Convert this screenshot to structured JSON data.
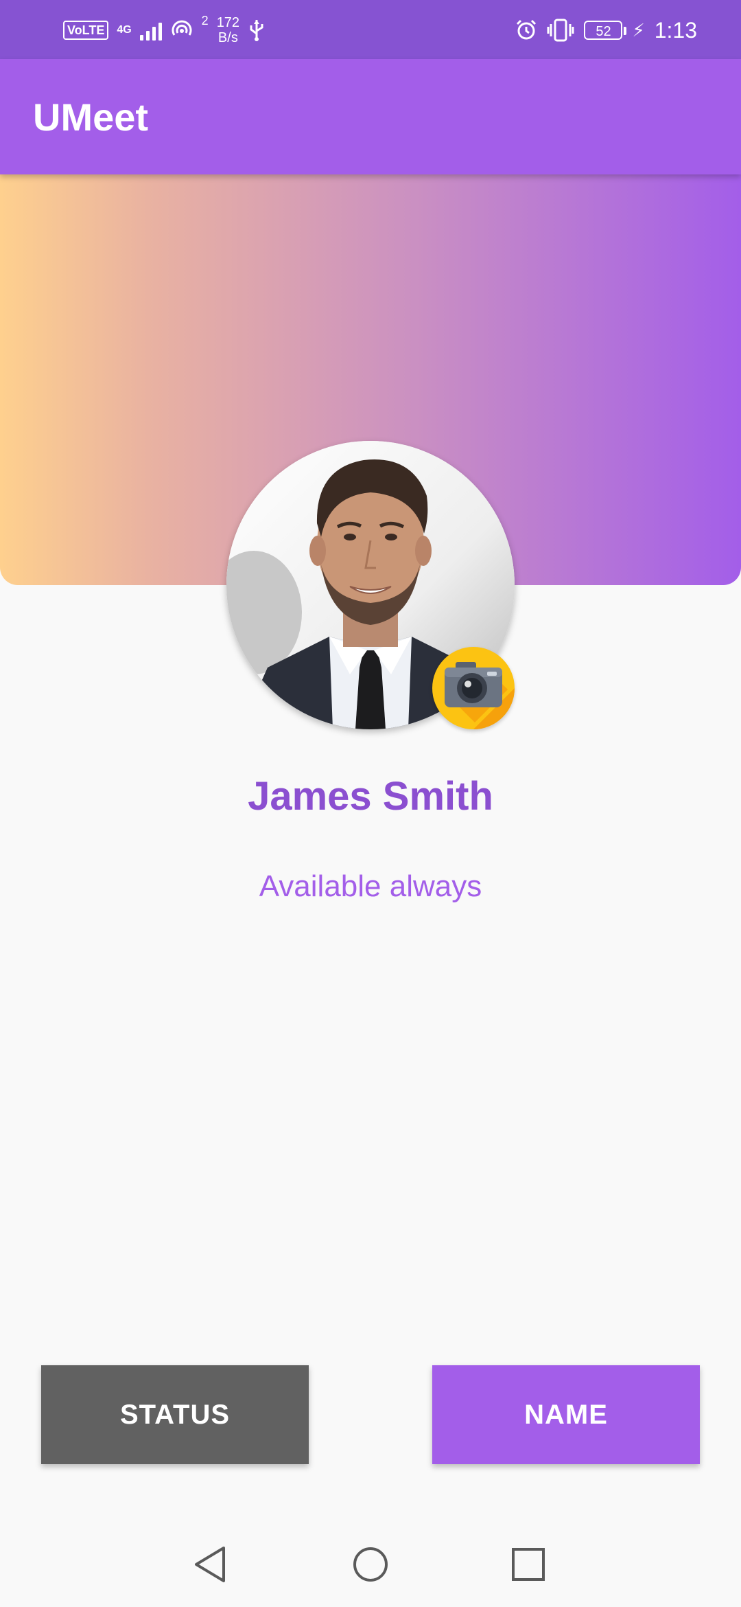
{
  "status_bar": {
    "network_badge": "VoLTE",
    "network_type": "4G",
    "hotspot_count": "2",
    "speed_value": "172",
    "speed_unit": "B/s",
    "battery": "52",
    "time": "1:13",
    "icons": [
      "volte-icon",
      "signal-icon",
      "hotspot-icon",
      "usb-icon",
      "alarm-icon",
      "vibrate-icon",
      "battery-icon",
      "charging-icon"
    ]
  },
  "app_bar": {
    "title": "UMeet"
  },
  "profile": {
    "name": "James Smith",
    "status": "Available always",
    "avatar_icon": "profile-photo",
    "edit_photo_icon": "camera-icon"
  },
  "actions": {
    "status_label": "STATUS",
    "name_label": "NAME"
  },
  "nav_bar": {
    "icons": [
      "back-icon",
      "home-icon",
      "recents-icon"
    ]
  },
  "colors": {
    "status_bar": "#8653d2",
    "accent": "#a35ee9",
    "name_text": "#8b4fd0",
    "gradient_start": "#fed08e",
    "status_button": "#616161",
    "camera_badge": "#fcc312"
  }
}
